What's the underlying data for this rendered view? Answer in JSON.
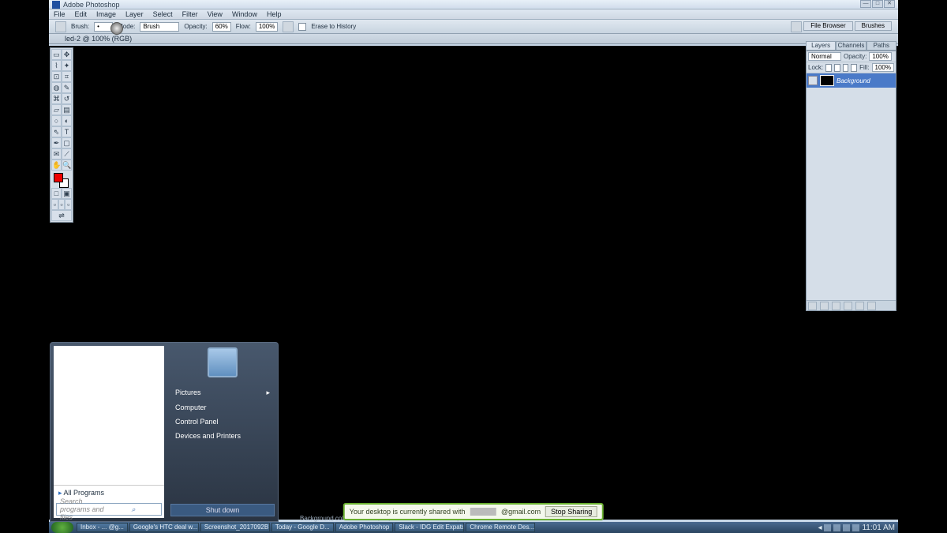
{
  "app": {
    "title": "Adobe Photoshop"
  },
  "menus": [
    "File",
    "Edit",
    "Image",
    "Layer",
    "Select",
    "Filter",
    "View",
    "Window",
    "Help"
  ],
  "options": {
    "brush_label": "Brush:",
    "mode_label": "Mode:",
    "mode_value": "Brush",
    "opacity_label": "Opacity:",
    "opacity_value": "60%",
    "flow_label": "Flow:",
    "flow_value": "100%",
    "erase_label": "Erase to History",
    "tabs": [
      "File Browser",
      "Brushes"
    ]
  },
  "document": {
    "title": "led-2 @ 100% (RGB)"
  },
  "panel": {
    "tabs": [
      "Layers",
      "Channels",
      "Paths"
    ],
    "blend": "Normal",
    "opacity_label": "Opacity:",
    "opacity_value": "100%",
    "lock_label": "Lock:",
    "fill_label": "Fill:",
    "fill_value": "100%",
    "layer_name": "Background"
  },
  "start": {
    "items": [
      "Pictures",
      "Computer",
      "Control Panel",
      "Devices and Printers"
    ],
    "all": "All Programs",
    "search": "Search programs and files",
    "shutdown": "Shut down"
  },
  "share": {
    "msg": "Your desktop is currently shared with",
    "email": "@gmail.com",
    "stop": "Stop Sharing"
  },
  "statusbar": "Background color. Use Shift, Alt, and Ctrl for additional options.",
  "taskbar": {
    "items": [
      "Inbox - ... @g...",
      "Google's HTC deal w...",
      "Screenshot_2017092B...",
      "Today - Google D...",
      "Adobe Photoshop",
      "Slack - IDG Edit Expats",
      "Chrome Remote Des..."
    ],
    "time": "11:01 AM"
  }
}
